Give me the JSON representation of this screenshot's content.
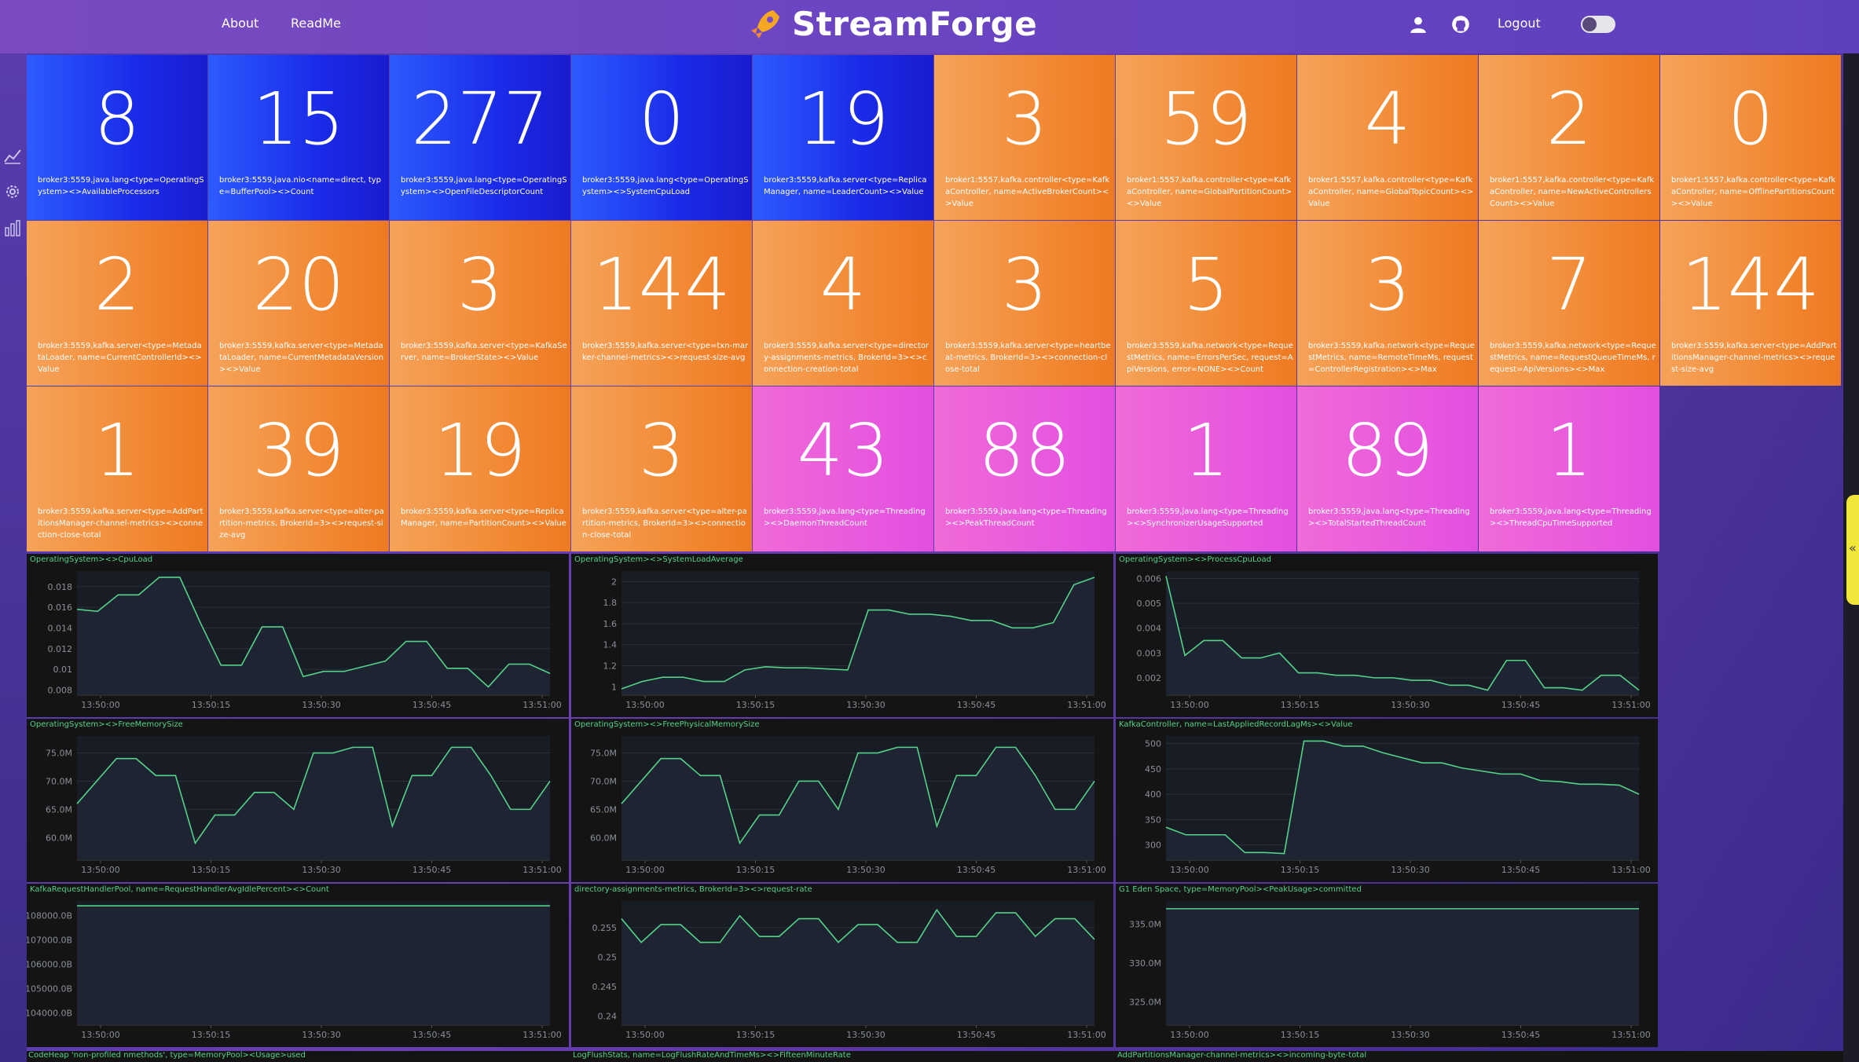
{
  "header": {
    "nav": [
      "About",
      "ReadMe"
    ],
    "brand": "StreamForge",
    "logout": "Logout"
  },
  "colors": {
    "blue": "#1a2be8",
    "orange": "#f28a35",
    "pink": "#e24fe0",
    "line": "#55d28a",
    "panel": "#141414"
  },
  "tiles": [
    {
      "value": "8",
      "label": "broker3:5559,java.lang<type=OperatingSystem><>AvailableProcessors",
      "color": "blue"
    },
    {
      "value": "15",
      "label": "broker3:5559,java.nio<name=direct, type=BufferPool><>Count",
      "color": "blue"
    },
    {
      "value": "277",
      "label": "broker3:5559,java.lang<type=OperatingSystem><>OpenFileDescriptorCount",
      "color": "blue"
    },
    {
      "value": "0",
      "label": "broker3:5559,java.lang<type=OperatingSystem><>SystemCpuLoad",
      "color": "blue"
    },
    {
      "value": "19",
      "label": "broker3:5559,kafka.server<type=ReplicaManager, name=LeaderCount><>Value",
      "color": "blue"
    },
    {
      "value": "3",
      "label": "broker1:5557,kafka.controller<type=KafkaController, name=ActiveBrokerCount><>Value",
      "color": "orange"
    },
    {
      "value": "59",
      "label": "broker1:5557,kafka.controller<type=KafkaController, name=GlobalPartitionCount><>Value",
      "color": "orange"
    },
    {
      "value": "4",
      "label": "broker1:5557,kafka.controller<type=KafkaController, name=GlobalTopicCount><>Value",
      "color": "orange"
    },
    {
      "value": "2",
      "label": "broker1:5557,kafka.controller<type=KafkaController, name=NewActiveControllersCount><>Value",
      "color": "orange"
    },
    {
      "value": "0",
      "label": "broker1:5557,kafka.controller<type=KafkaController, name=OfflinePartitionsCount><>Value",
      "color": "orange"
    },
    {
      "value": "2",
      "label": "broker3:5559,kafka.server<type=MetadataLoader, name=CurrentControllerId><>Value",
      "color": "orange"
    },
    {
      "value": "20",
      "label": "broker3:5559,kafka.server<type=MetadataLoader, name=CurrentMetadataVersion><>Value",
      "color": "orange"
    },
    {
      "value": "3",
      "label": "broker3:5559,kafka.server<type=KafkaServer, name=BrokerState><>Value",
      "color": "orange"
    },
    {
      "value": "144",
      "label": "broker3:5559,kafka.server<type=txn-marker-channel-metrics><>request-size-avg",
      "color": "orange"
    },
    {
      "value": "4",
      "label": "broker3:5559,kafka.server<type=directory-assignments-metrics, BrokerId=3><>connection-creation-total",
      "color": "orange"
    },
    {
      "value": "3",
      "label": "broker3:5559,kafka.server<type=heartbeat-metrics, BrokerId=3><>connection-close-total",
      "color": "orange"
    },
    {
      "value": "5",
      "label": "broker3:5559,kafka.network<type=RequestMetrics, name=ErrorsPerSec, request=ApiVersions, error=NONE><>Count",
      "color": "orange"
    },
    {
      "value": "3",
      "label": "broker3:5559,kafka.network<type=RequestMetrics, name=RemoteTimeMs, request=ControllerRegistration><>Max",
      "color": "orange"
    },
    {
      "value": "7",
      "label": "broker3:5559,kafka.network<type=RequestMetrics, name=RequestQueueTimeMs, request=ApiVersions><>Max",
      "color": "orange"
    },
    {
      "value": "144",
      "label": "broker3:5559,kafka.server<type=AddPartitionsManager-channel-metrics><>request-size-avg",
      "color": "orange"
    },
    {
      "value": "1",
      "label": "broker3:5559,kafka.server<type=AddPartitionsManager-channel-metrics><>connection-close-total",
      "color": "orange"
    },
    {
      "value": "39",
      "label": "broker3:5559,kafka.server<type=alter-partition-metrics, BrokerId=3><>request-size-avg",
      "color": "orange"
    },
    {
      "value": "19",
      "label": "broker3:5559,kafka.server<type=ReplicaManager, name=PartitionCount><>Value",
      "color": "orange"
    },
    {
      "value": "3",
      "label": "broker3:5559,kafka.server<type=alter-partition-metrics, BrokerId=3><>connection-close-total",
      "color": "orange"
    },
    {
      "value": "43",
      "label": "broker3:5559,java.lang<type=Threading><>DaemonThreadCount",
      "color": "pink"
    },
    {
      "value": "88",
      "label": "broker3:5559,java.lang<type=Threading><>PeakThreadCount",
      "color": "pink"
    },
    {
      "value": "1",
      "label": "broker3:5559,java.lang<type=Threading><>SynchronizerUsageSupported",
      "color": "pink"
    },
    {
      "value": "89",
      "label": "broker3:5559,java.lang<type=Threading><>TotalStartedThreadCount",
      "color": "pink"
    },
    {
      "value": "1",
      "label": "broker3:5559,java.lang<type=Threading><>ThreadCpuTimeSupported",
      "color": "pink"
    }
  ],
  "charts": [
    {
      "title": "OperatingSystem><>CpuLoad",
      "yticks": [
        "0.018",
        "0.016",
        "0.014",
        "0.012",
        "0.01",
        "0.008"
      ],
      "ylim": [
        0.0075,
        0.0195
      ],
      "values": [
        0.0158,
        0.0156,
        0.0172,
        0.0172,
        0.0189,
        0.0189,
        0.0145,
        0.0104,
        0.0104,
        0.0141,
        0.0141,
        0.0093,
        0.0098,
        0.0098,
        0.0103,
        0.0108,
        0.0127,
        0.0127,
        0.0101,
        0.0101,
        0.0083,
        0.0105,
        0.0105,
        0.0096
      ]
    },
    {
      "title": "OperatingSystem><>SystemLoadAverage",
      "yticks": [
        "2",
        "1.8",
        "1.6",
        "1.4",
        "1.2",
        "1"
      ],
      "ylim": [
        0.92,
        2.1
      ],
      "values": [
        0.98,
        1.05,
        1.09,
        1.09,
        1.05,
        1.05,
        1.16,
        1.19,
        1.18,
        1.18,
        1.17,
        1.16,
        1.73,
        1.73,
        1.69,
        1.69,
        1.67,
        1.63,
        1.63,
        1.56,
        1.56,
        1.61,
        1.97,
        2.04
      ]
    },
    {
      "title": "OperatingSystem><>ProcessCpuLoad",
      "yticks": [
        "0.006",
        "0.005",
        "0.004",
        "0.003",
        "0.002"
      ],
      "ylim": [
        0.0013,
        0.0063
      ],
      "values": [
        0.0061,
        0.0029,
        0.0035,
        0.0035,
        0.0028,
        0.0028,
        0.003,
        0.0022,
        0.0022,
        0.0021,
        0.0021,
        0.002,
        0.002,
        0.0019,
        0.0019,
        0.0017,
        0.0017,
        0.0015,
        0.0027,
        0.0027,
        0.0016,
        0.0016,
        0.0015,
        0.0021,
        0.0021,
        0.0015
      ]
    },
    {
      "title": "OperatingSystem><>FreeMemorySize",
      "yticks": [
        "75.0M",
        "70.0M",
        "65.0M",
        "60.0M"
      ],
      "ylim": [
        56,
        78
      ],
      "values": [
        66,
        70,
        74,
        74,
        71,
        71,
        59,
        64,
        64,
        68,
        68,
        65,
        75,
        75,
        76,
        76,
        62,
        71,
        71,
        76,
        76,
        71,
        65,
        65,
        70
      ]
    },
    {
      "title": "OperatingSystem><>FreePhysicalMemorySize",
      "yticks": [
        "75.0M",
        "70.0M",
        "65.0M",
        "60.0M"
      ],
      "ylim": [
        56,
        78
      ],
      "values": [
        66,
        70,
        74,
        74,
        71,
        71,
        59,
        64,
        64,
        70,
        70,
        65,
        75,
        75,
        76,
        76,
        62,
        71,
        71,
        76,
        76,
        71,
        65,
        65,
        70
      ]
    },
    {
      "title": "KafkaController, name=LastAppliedRecordLagMs><>Value",
      "yticks": [
        "500",
        "450",
        "400",
        "350",
        "300"
      ],
      "ylim": [
        270,
        515
      ],
      "values": [
        335,
        320,
        320,
        320,
        285,
        285,
        283,
        505,
        505,
        495,
        495,
        482,
        472,
        462,
        462,
        452,
        446,
        440,
        440,
        427,
        425,
        420,
        420,
        418,
        400
      ]
    },
    {
      "title": "KafkaRequestHandlerPool, name=RequestHandlerAvgIdlePercent><>Count",
      "yticks": [
        "108000.0B",
        "107000.0B",
        "106000.0B",
        "105000.0B",
        "104000.0B"
      ],
      "ylim": [
        103500,
        108600
      ],
      "values": [
        108400,
        108400,
        108400,
        108400,
        108400,
        108400,
        108400,
        108400,
        108400,
        108400,
        108400,
        108400,
        108400,
        108400,
        108400,
        108400,
        108400,
        108400,
        108400,
        108400,
        108400,
        108400,
        108400,
        108400,
        108400
      ]
    },
    {
      "title": "directory-assignments-metrics, BrokerId=3><>request-rate",
      "yticks": [
        "0.255",
        "0.25",
        "0.245",
        "0.24"
      ],
      "ylim": [
        0.2385,
        0.2595
      ],
      "values": [
        0.2565,
        0.2525,
        0.2555,
        0.2555,
        0.2525,
        0.2525,
        0.257,
        0.2535,
        0.2535,
        0.2565,
        0.2565,
        0.2525,
        0.2555,
        0.2555,
        0.2525,
        0.2525,
        0.258,
        0.2535,
        0.2535,
        0.2575,
        0.2575,
        0.2535,
        0.2565,
        0.2565,
        0.253
      ]
    },
    {
      "title": "G1 Eden Space, type=MemoryPool><PeakUsage>committed",
      "yticks": [
        "335.0M",
        "330.0M",
        "325.0M"
      ],
      "ylim": [
        322,
        338
      ],
      "values": [
        337,
        337,
        337,
        337,
        337,
        337,
        337,
        337,
        337,
        337,
        337,
        337,
        337,
        337,
        337,
        337,
        337,
        337,
        337,
        337,
        337,
        337,
        337,
        337,
        337
      ]
    }
  ],
  "xticks": [
    "13:50:00",
    "13:50:15",
    "13:50:30",
    "13:50:45",
    "13:51:00"
  ],
  "bottom_titles": [
    "CodeHeap 'non-profiled nmethods', type=MemoryPool><Usage>used",
    "LogFlushStats, name=LogFlushRateAndTimeMs><>FifteenMinuteRate",
    "AddPartitionsManager-channel-metrics><>incoming-byte-total"
  ],
  "toggle_tab": "«"
}
